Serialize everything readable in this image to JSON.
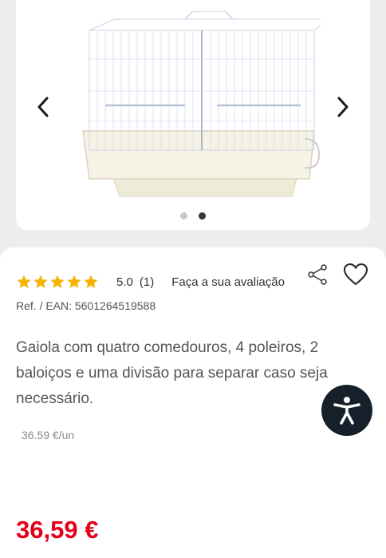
{
  "gallery": {
    "product_image_alt": "bird-cage-image",
    "image_count": 2,
    "active_index": 1,
    "prev_icon": "chevron-left-icon",
    "next_icon": "chevron-right-icon"
  },
  "product": {
    "rating_stars": 5,
    "rating_value": "5.0",
    "rating_count": "(1)",
    "review_link": "Faça a sua avaliação",
    "ref": "Ref. / EAN: 5601264519588",
    "description": "Gaiola com quatro comedouros, 4 poleiros, 2 baloiços e uma divisão para separar caso seja necessário.",
    "unit_price": "36.59 €/un",
    "price": "36,59 €",
    "share_icon": "share-icon",
    "favorite_icon": "heart-icon",
    "accessibility_icon": "accessibility-icon"
  },
  "colors": {
    "star": "#f5b400",
    "price": "#e2001a",
    "accessibility_bg": "#15202b"
  }
}
